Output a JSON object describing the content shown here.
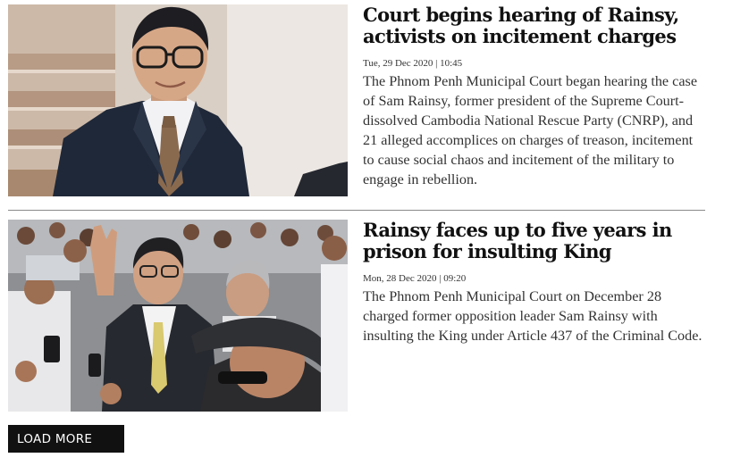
{
  "articles": [
    {
      "title": "Court begins hearing of Rainsy, activists on incitement charges",
      "timestamp": "Tue, 29 Dec 2020 | 10:45",
      "summary": "The Phnom Penh Municipal Court began hearing the case of Sam Rainsy, former president of the Supreme Court-dissolved Cambodia National Rescue Party (CNRP), and 21 alleged accomplices on charges of treason, incitement to cause social chaos and incitement of the military to engage in rebellion.",
      "image_description": "portrait-photo"
    },
    {
      "title": "Rainsy faces up to five years in prison for insulting King",
      "timestamp": "Mon, 28 Dec 2020 | 09:20",
      "summary": "The Phnom Penh Municipal Court on December 28 charged former opposition leader Sam Rainsy with insulting the King under Article 437 of the Criminal Code.",
      "image_description": "crowd-photo"
    }
  ],
  "load_more_label": "LOAD MORE",
  "colors": {
    "button_bg": "#111111",
    "button_text": "#ffffff",
    "headline": "#111111",
    "body_text": "#333333",
    "divider": "#8a8a8a"
  }
}
